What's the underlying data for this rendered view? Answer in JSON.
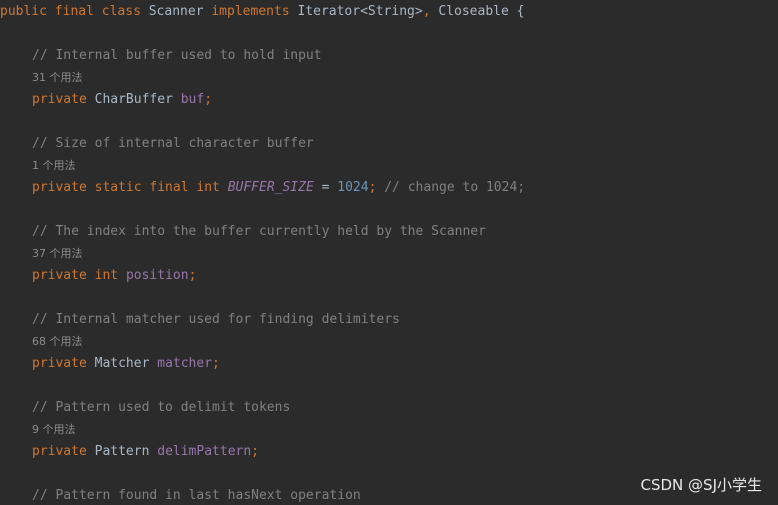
{
  "class_decl": {
    "kw_public": "public",
    "kw_final": "final",
    "kw_class": "class",
    "class_name": "Scanner",
    "kw_implements": "implements",
    "iface1": "Iterator<String>",
    "comma": ",",
    "iface2": "Closeable",
    "brace": "{"
  },
  "members": [
    {
      "comment": "// Internal buffer used to hold input",
      "usages": "31 个用法",
      "modifiers": "private",
      "type": "CharBuffer",
      "name": "buf",
      "semicolon": ";"
    },
    {
      "comment": "// Size of internal character buffer",
      "usages": "1 个用法",
      "modifiers": "private static final",
      "type": "int",
      "name": "BUFFER_SIZE",
      "equals": "=",
      "value": "1024",
      "semicolon": ";",
      "trailing_comment": "// change to 1024;"
    },
    {
      "comment": "// The index into the buffer currently held by the Scanner",
      "usages": "37 个用法",
      "modifiers": "private",
      "type": "int",
      "name": "position",
      "semicolon": ";"
    },
    {
      "comment": "// Internal matcher used for finding delimiters",
      "usages": "68 个用法",
      "modifiers": "private",
      "type": "Matcher",
      "name": "matcher",
      "semicolon": ";"
    },
    {
      "comment": "// Pattern used to delimit tokens",
      "usages": "9 个用法",
      "modifiers": "private",
      "type": "Pattern",
      "name": "delimPattern",
      "semicolon": ";"
    },
    {
      "comment": "// Pattern found in last hasNext operation"
    }
  ],
  "watermark": "CSDN @SJ小学生",
  "colors": {
    "background": "#2b2b2b",
    "keyword": "#cc7832",
    "comment": "#808080",
    "field": "#9876aa",
    "number": "#6897bb",
    "default_text": "#a9b7c6"
  }
}
